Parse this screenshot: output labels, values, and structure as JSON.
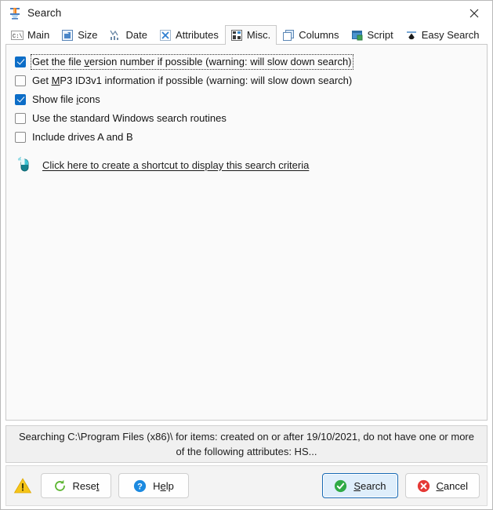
{
  "window": {
    "title": "Search",
    "title_icon": "search-app-icon",
    "close_label": "Close"
  },
  "tabs": [
    {
      "label": "Main",
      "icon": "console-icon",
      "icon_text": "C:\\",
      "active": false
    },
    {
      "label": "Size",
      "icon": "size-icon",
      "active": false
    },
    {
      "label": "Date",
      "icon": "date-chart-icon",
      "active": false
    },
    {
      "label": "Attributes",
      "icon": "attributes-icon",
      "active": false
    },
    {
      "label": "Misc.",
      "icon": "misc-icon",
      "active": true
    },
    {
      "label": "Columns",
      "icon": "columns-icon",
      "active": false
    },
    {
      "label": "Script",
      "icon": "script-icon",
      "active": false
    },
    {
      "label": "Easy Search",
      "icon": "easy-search-icon",
      "active": false
    }
  ],
  "options": [
    {
      "id": "file-version",
      "checked": true,
      "focused": true,
      "pre": "Get the file ",
      "accel": "v",
      "post": "ersion number if possible (warning: will slow down search)"
    },
    {
      "id": "mp3-id3v1",
      "checked": false,
      "focused": false,
      "pre": "Get ",
      "accel": "M",
      "post": "P3 ID3v1 information if possible (warning: will slow down search)"
    },
    {
      "id": "show-file-icons",
      "checked": true,
      "focused": false,
      "pre": "Show file ",
      "accel": "i",
      "post": "cons"
    },
    {
      "id": "standard-windows-search",
      "checked": false,
      "focused": false,
      "pre": "Use the standard Windows search routines",
      "accel": "",
      "post": ""
    },
    {
      "id": "include-drives-ab",
      "checked": false,
      "focused": false,
      "pre": "Include drives A and B",
      "accel": "",
      "post": ""
    }
  ],
  "shortcut_link": {
    "icon": "mouse-click-icon",
    "text": "Click here to create a shortcut to display this search criteria"
  },
  "status": {
    "text": "Searching C:\\Program Files (x86)\\ for items: created on or after 19/10/2021, do not have one or more of the following attributes: HS..."
  },
  "footer": {
    "warning_icon": "warning-triangle-icon",
    "buttons": [
      {
        "id": "reset",
        "icon": "refresh-icon",
        "pre": "Rese",
        "accel": "t",
        "post": "",
        "default": false
      },
      {
        "id": "help",
        "icon": "question-icon",
        "pre": "H",
        "accel": "e",
        "post": "lp",
        "default": false
      },
      {
        "id": "search",
        "icon": "check-circle-icon",
        "pre": "",
        "accel": "S",
        "post": "earch",
        "default": true
      },
      {
        "id": "cancel",
        "icon": "cancel-circle-icon",
        "pre": "",
        "accel": "C",
        "post": "ancel",
        "default": false
      }
    ]
  },
  "colors": {
    "accent_blue": "#0c6dc7",
    "default_button_border": "#1669b5",
    "default_button_fill": "#dfeefb",
    "panel_bg": "#fafafa",
    "status_bg": "#f0f0f0",
    "footer_bg": "#f3f3f3",
    "warning_yellow": "#ffc107",
    "search_green": "#2faa46",
    "cancel_red": "#e53935",
    "help_blue": "#1c8ae0",
    "reset_green": "#5cb531",
    "link_teal": "#1b9aa8"
  }
}
